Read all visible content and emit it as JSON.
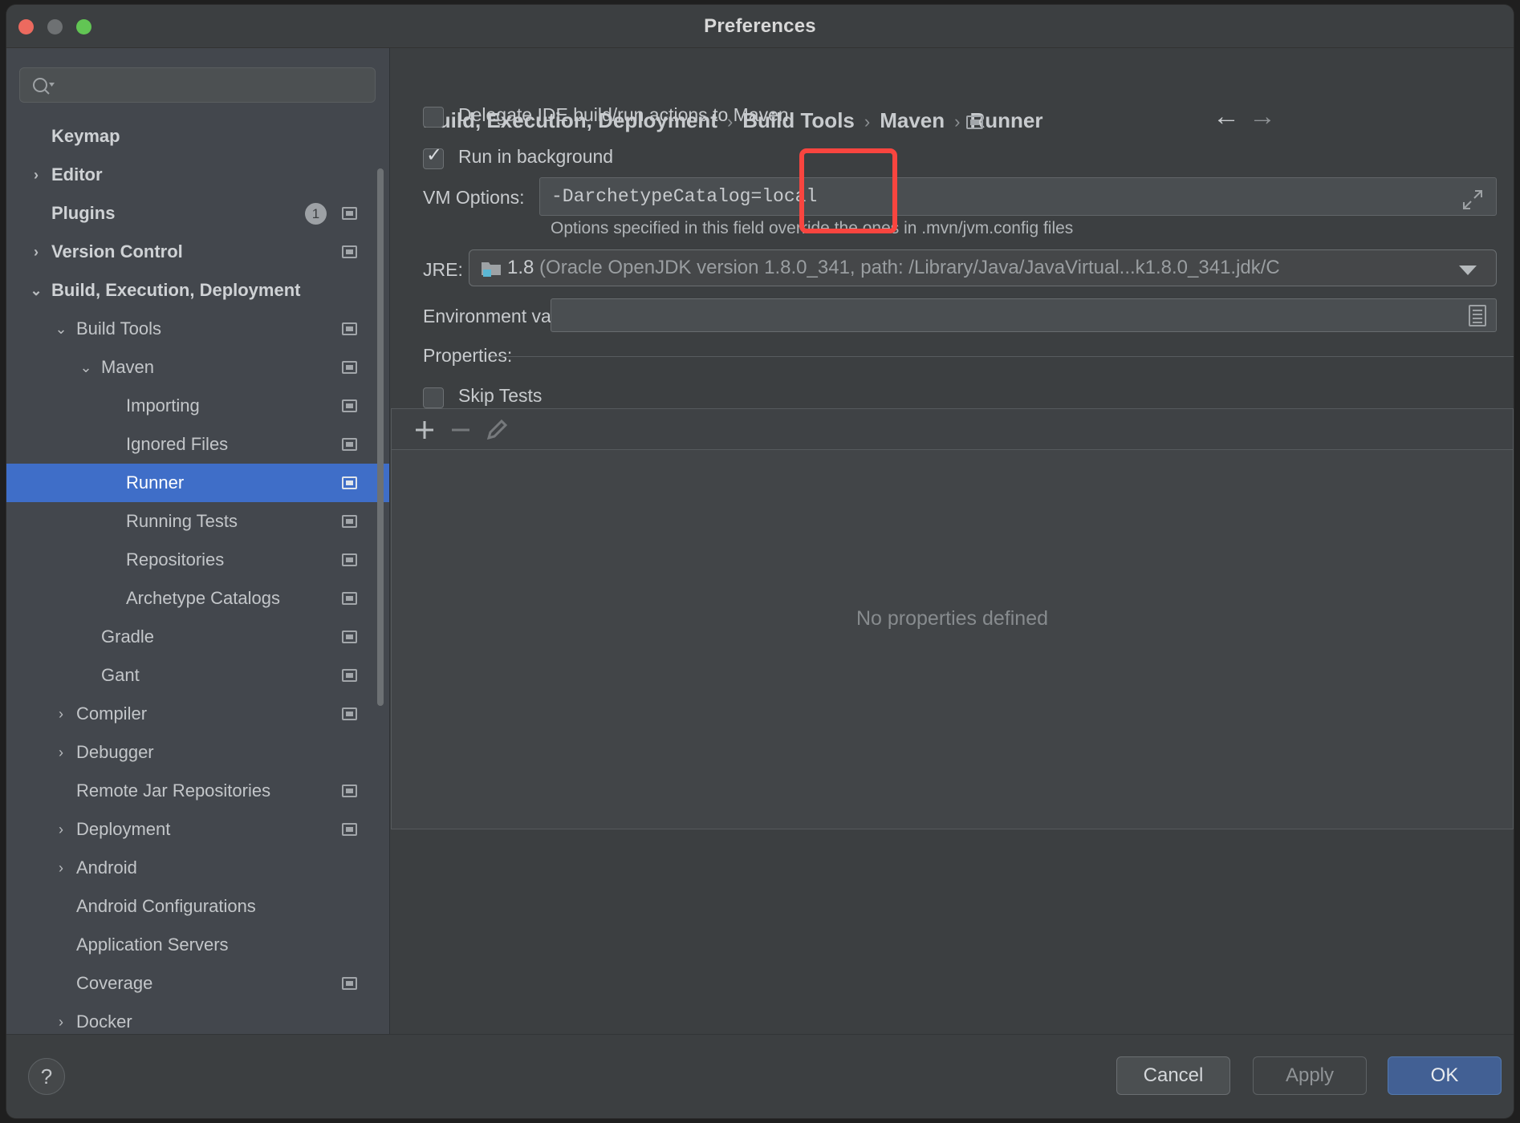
{
  "window": {
    "title": "Preferences",
    "traffic_lights": [
      "close",
      "minimize",
      "maximize"
    ]
  },
  "sidebar": {
    "search": {
      "value": "",
      "placeholder": "",
      "icon": "search-icon"
    },
    "items": [
      {
        "label": "Keymap",
        "indent": 0,
        "chevron": "",
        "bold": true,
        "badge": "",
        "endicon": false,
        "selected": false
      },
      {
        "label": "Editor",
        "indent": 0,
        "chevron": "›",
        "bold": true,
        "badge": "",
        "endicon": false,
        "selected": false
      },
      {
        "label": "Plugins",
        "indent": 0,
        "chevron": "",
        "bold": true,
        "badge": "1",
        "endicon": true,
        "selected": false
      },
      {
        "label": "Version Control",
        "indent": 0,
        "chevron": "›",
        "bold": true,
        "badge": "",
        "endicon": true,
        "selected": false
      },
      {
        "label": "Build, Execution, Deployment",
        "indent": 0,
        "chevron": "⌄",
        "bold": true,
        "badge": "",
        "endicon": false,
        "selected": false
      },
      {
        "label": "Build Tools",
        "indent": 1,
        "chevron": "⌄",
        "bold": false,
        "badge": "",
        "endicon": true,
        "selected": false
      },
      {
        "label": "Maven",
        "indent": 2,
        "chevron": "⌄",
        "bold": false,
        "badge": "",
        "endicon": true,
        "selected": false
      },
      {
        "label": "Importing",
        "indent": 3,
        "chevron": "",
        "bold": false,
        "badge": "",
        "endicon": true,
        "selected": false
      },
      {
        "label": "Ignored Files",
        "indent": 3,
        "chevron": "",
        "bold": false,
        "badge": "",
        "endicon": true,
        "selected": false
      },
      {
        "label": "Runner",
        "indent": 3,
        "chevron": "",
        "bold": false,
        "badge": "",
        "endicon": true,
        "selected": true
      },
      {
        "label": "Running Tests",
        "indent": 3,
        "chevron": "",
        "bold": false,
        "badge": "",
        "endicon": true,
        "selected": false
      },
      {
        "label": "Repositories",
        "indent": 3,
        "chevron": "",
        "bold": false,
        "badge": "",
        "endicon": true,
        "selected": false
      },
      {
        "label": "Archetype Catalogs",
        "indent": 3,
        "chevron": "",
        "bold": false,
        "badge": "",
        "endicon": true,
        "selected": false
      },
      {
        "label": "Gradle",
        "indent": 2,
        "chevron": "",
        "bold": false,
        "badge": "",
        "endicon": true,
        "selected": false
      },
      {
        "label": "Gant",
        "indent": 2,
        "chevron": "",
        "bold": false,
        "badge": "",
        "endicon": true,
        "selected": false
      },
      {
        "label": "Compiler",
        "indent": 1,
        "chevron": "›",
        "bold": false,
        "badge": "",
        "endicon": true,
        "selected": false
      },
      {
        "label": "Debugger",
        "indent": 1,
        "chevron": "›",
        "bold": false,
        "badge": "",
        "endicon": false,
        "selected": false
      },
      {
        "label": "Remote Jar Repositories",
        "indent": 1,
        "chevron": "",
        "bold": false,
        "badge": "",
        "endicon": true,
        "selected": false
      },
      {
        "label": "Deployment",
        "indent": 1,
        "chevron": "›",
        "bold": false,
        "badge": "",
        "endicon": true,
        "selected": false
      },
      {
        "label": "Android",
        "indent": 1,
        "chevron": "›",
        "bold": false,
        "badge": "",
        "endicon": false,
        "selected": false
      },
      {
        "label": "Android Configurations",
        "indent": 1,
        "chevron": "",
        "bold": false,
        "badge": "",
        "endicon": false,
        "selected": false
      },
      {
        "label": "Application Servers",
        "indent": 1,
        "chevron": "",
        "bold": false,
        "badge": "",
        "endicon": false,
        "selected": false
      },
      {
        "label": "Coverage",
        "indent": 1,
        "chevron": "",
        "bold": false,
        "badge": "",
        "endicon": true,
        "selected": false
      },
      {
        "label": "Docker",
        "indent": 1,
        "chevron": "›",
        "bold": false,
        "badge": "",
        "endicon": false,
        "selected": false
      }
    ]
  },
  "content": {
    "breadcrumb": {
      "parts": [
        "Build, Execution, Deployment",
        "Build Tools",
        "Maven",
        "Runner"
      ],
      "separator": "›"
    },
    "nav": {
      "back": "←",
      "forward": "→"
    },
    "delegate_checkbox": {
      "label": "Delegate IDE build/run actions to Maven",
      "checked": false
    },
    "run_background_checkbox": {
      "label": "Run in background",
      "checked": true
    },
    "vm_options": {
      "label": "VM Options:",
      "value": "-DarchetypeCatalog=local",
      "placeholder": "",
      "expand_icon": "expand-icon",
      "hint": "Options specified in this field override the ones in .mvn/jvm.config files"
    },
    "jre": {
      "label": "JRE:",
      "version": "1.8",
      "detail": "(Oracle OpenJDK version 1.8.0_341, path: /Library/Java/JavaVirtual...k1.8.0_341.jdk/C",
      "caret": "chevron-down-icon"
    },
    "env_vars": {
      "label": "Environment variables:",
      "value": "",
      "placeholder": "",
      "browse_icon": "list-icon"
    },
    "properties": {
      "label": "Properties:",
      "skip_tests": {
        "label": "Skip Tests",
        "checked": false
      },
      "toolbar": {
        "add": "+",
        "remove": "−",
        "edit": "pencil-icon"
      },
      "empty_text": "No properties defined",
      "rows": []
    },
    "annotation": {
      "type": "highlight-box",
      "color": "#f9453f"
    }
  },
  "footer": {
    "help": "?",
    "cancel": "Cancel",
    "apply": "Apply",
    "ok": "OK"
  },
  "colors": {
    "accent": "#3f6ec8",
    "ok_button": "#426094",
    "annotation": "#f9453f",
    "window_bg": "#3c3f41",
    "sidebar_bg": "#43474d"
  }
}
